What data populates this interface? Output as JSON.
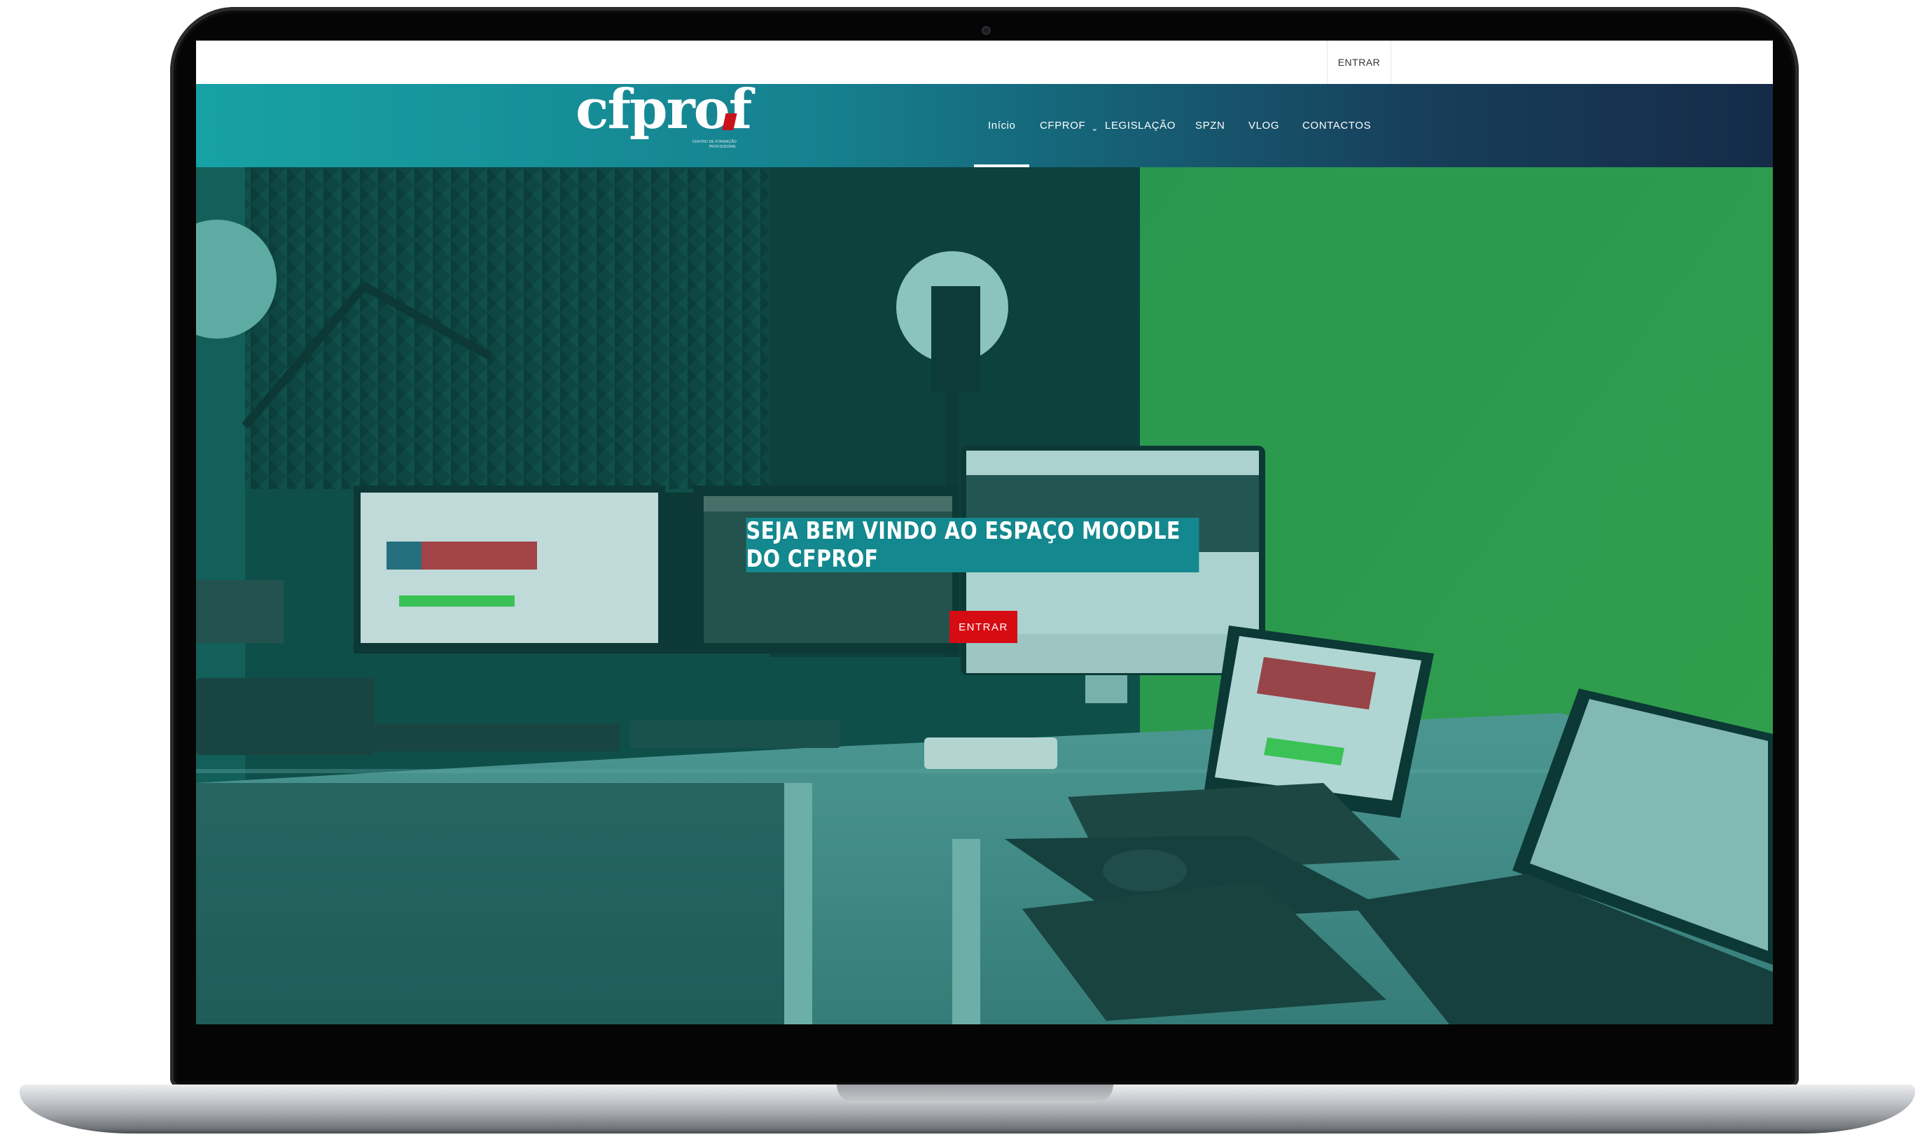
{
  "topbar": {
    "login_label": "ENTRAR"
  },
  "header": {
    "logo_text": "cfprof",
    "logo_tagline": "CENTRO DE FORMAÇÃO PROFISSIONAL",
    "nav": [
      {
        "label": "Início",
        "active": true
      },
      {
        "label": "CFPROF",
        "has_dropdown": true
      },
      {
        "label": "LEGISLAÇÃO"
      },
      {
        "label": "SPZN"
      },
      {
        "label": "VLOG"
      },
      {
        "label": "CONTACTOS"
      }
    ]
  },
  "hero": {
    "title": "SEJA BEM VINDO AO ESPAÇO MOODLE DO CFPROF",
    "button_label": "ENTRAR"
  },
  "colors": {
    "nav_gradient_start": "#17a2a5",
    "nav_gradient_end": "#152b48",
    "hero_overlay": "#0f7a7a",
    "green_screen": "#3fae42",
    "title_background": "#13888e",
    "button_background": "#d60c13"
  },
  "icons": {
    "dropdown": "chevron-down-icon"
  }
}
